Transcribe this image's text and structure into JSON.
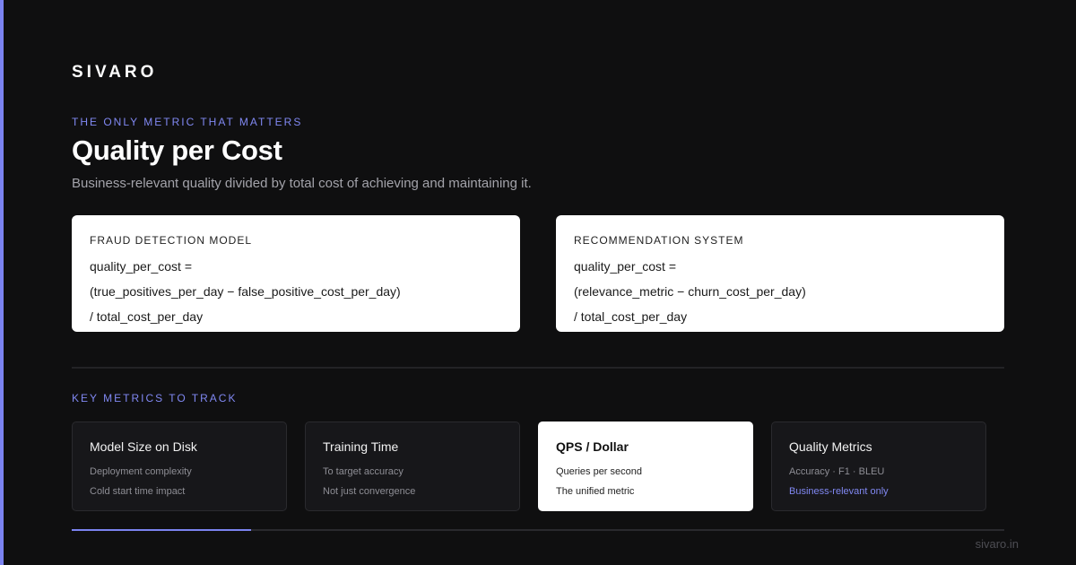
{
  "brand": "SIVARO",
  "eyebrow": "THE ONLY METRIC THAT MATTERS",
  "title": "Quality per Cost",
  "subtitle": "Business-relevant quality divided by total cost of achieving and maintaining it.",
  "formula_cards": [
    {
      "label": "FRAUD DETECTION MODEL",
      "lines": [
        "quality_per_cost =",
        "(true_positives_per_day − false_positive_cost_per_day)",
        "/ total_cost_per_day"
      ]
    },
    {
      "label": "RECOMMENDATION SYSTEM",
      "lines": [
        "quality_per_cost =",
        "(relevance_metric − churn_cost_per_day)",
        "/ total_cost_per_day"
      ]
    }
  ],
  "section_label": "KEY METRICS TO TRACK",
  "metrics": [
    {
      "title": "Model Size on Disk",
      "lines": [
        "Deployment complexity",
        "Cold start time impact"
      ]
    },
    {
      "title": "Training Time",
      "lines": [
        "To target accuracy",
        "Not just convergence"
      ]
    },
    {
      "title": "QPS / Dollar",
      "lines": [
        "Queries per second",
        "The unified metric"
      ],
      "highlighted": true
    },
    {
      "title": "Quality Metrics",
      "lines": [
        "Accuracy · F1 · BLEU",
        "Business-relevant only"
      ]
    }
  ],
  "progress": {
    "fraction": 0.1923
  },
  "footer": "sivaro.in",
  "colors": {
    "background": "#0f0f10",
    "accent": "#7b83f0",
    "card": "#ffffff",
    "dark_card": "#17171a"
  }
}
